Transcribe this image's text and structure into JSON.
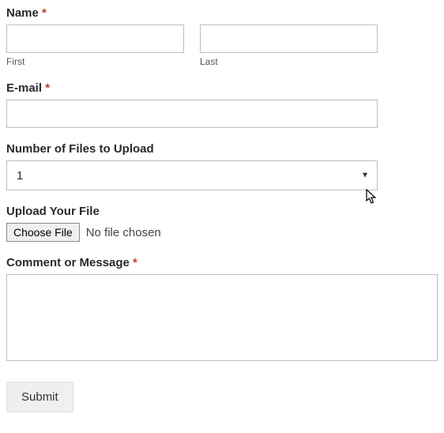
{
  "form": {
    "name": {
      "label": "Name",
      "required": "*",
      "first_sublabel": "First",
      "last_sublabel": "Last",
      "first_value": "",
      "last_value": ""
    },
    "email": {
      "label": "E-mail",
      "required": "*",
      "value": ""
    },
    "files_count": {
      "label": "Number of Files to Upload",
      "selected": "1"
    },
    "upload": {
      "label": "Upload Your File",
      "button": "Choose File",
      "status": "No file chosen"
    },
    "comment": {
      "label": "Comment or Message",
      "required": "*",
      "value": ""
    },
    "submit": {
      "label": "Submit"
    }
  }
}
